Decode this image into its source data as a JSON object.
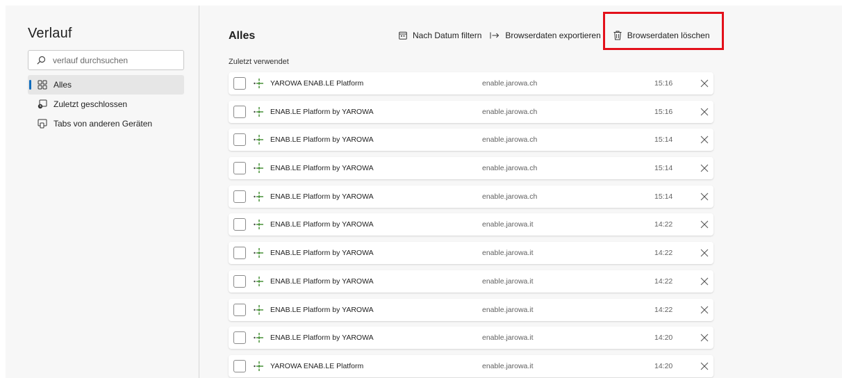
{
  "sidebar": {
    "title": "Verlauf",
    "search_placeholder": "verlauf durchsuchen",
    "items": [
      {
        "label": "Alles",
        "icon": "grid-icon",
        "active": true
      },
      {
        "label": "Zuletzt geschlossen",
        "icon": "recently-closed-icon"
      },
      {
        "label": "Tabs von anderen Geräten",
        "icon": "devices-icon"
      }
    ]
  },
  "main": {
    "title": "Alles",
    "toolbar": {
      "filter_label": "Nach Datum filtern",
      "export_label": "Browserdaten exportieren",
      "clear_label": "Browserdaten löschen"
    },
    "section_label": "Zuletzt verwendet",
    "rows": [
      {
        "title": "YAROWA ENAB.LE Platform",
        "url": "enable.jarowa.ch",
        "time": "15:16"
      },
      {
        "title": "ENAB.LE Platform by YAROWA",
        "url": "enable.jarowa.ch",
        "time": "15:16"
      },
      {
        "title": "ENAB.LE Platform by YAROWA",
        "url": "enable.jarowa.ch",
        "time": "15:14"
      },
      {
        "title": "ENAB.LE Platform by YAROWA",
        "url": "enable.jarowa.ch",
        "time": "15:14"
      },
      {
        "title": "ENAB.LE Platform by YAROWA",
        "url": "enable.jarowa.ch",
        "time": "15:14"
      },
      {
        "title": "ENAB.LE Platform by YAROWA",
        "url": "enable.jarowa.it",
        "time": "14:22"
      },
      {
        "title": "ENAB.LE Platform by YAROWA",
        "url": "enable.jarowa.it",
        "time": "14:22"
      },
      {
        "title": "ENAB.LE Platform by YAROWA",
        "url": "enable.jarowa.it",
        "time": "14:22"
      },
      {
        "title": "ENAB.LE Platform by YAROWA",
        "url": "enable.jarowa.it",
        "time": "14:22"
      },
      {
        "title": "ENAB.LE Platform by YAROWA",
        "url": "enable.jarowa.it",
        "time": "14:20"
      },
      {
        "title": "YAROWA ENAB.LE Platform",
        "url": "enable.jarowa.it",
        "time": "14:20"
      }
    ]
  },
  "colors": {
    "accent": "#0f6cbd",
    "highlight": "#e3101a",
    "site_icon": "#3a8a2a"
  }
}
